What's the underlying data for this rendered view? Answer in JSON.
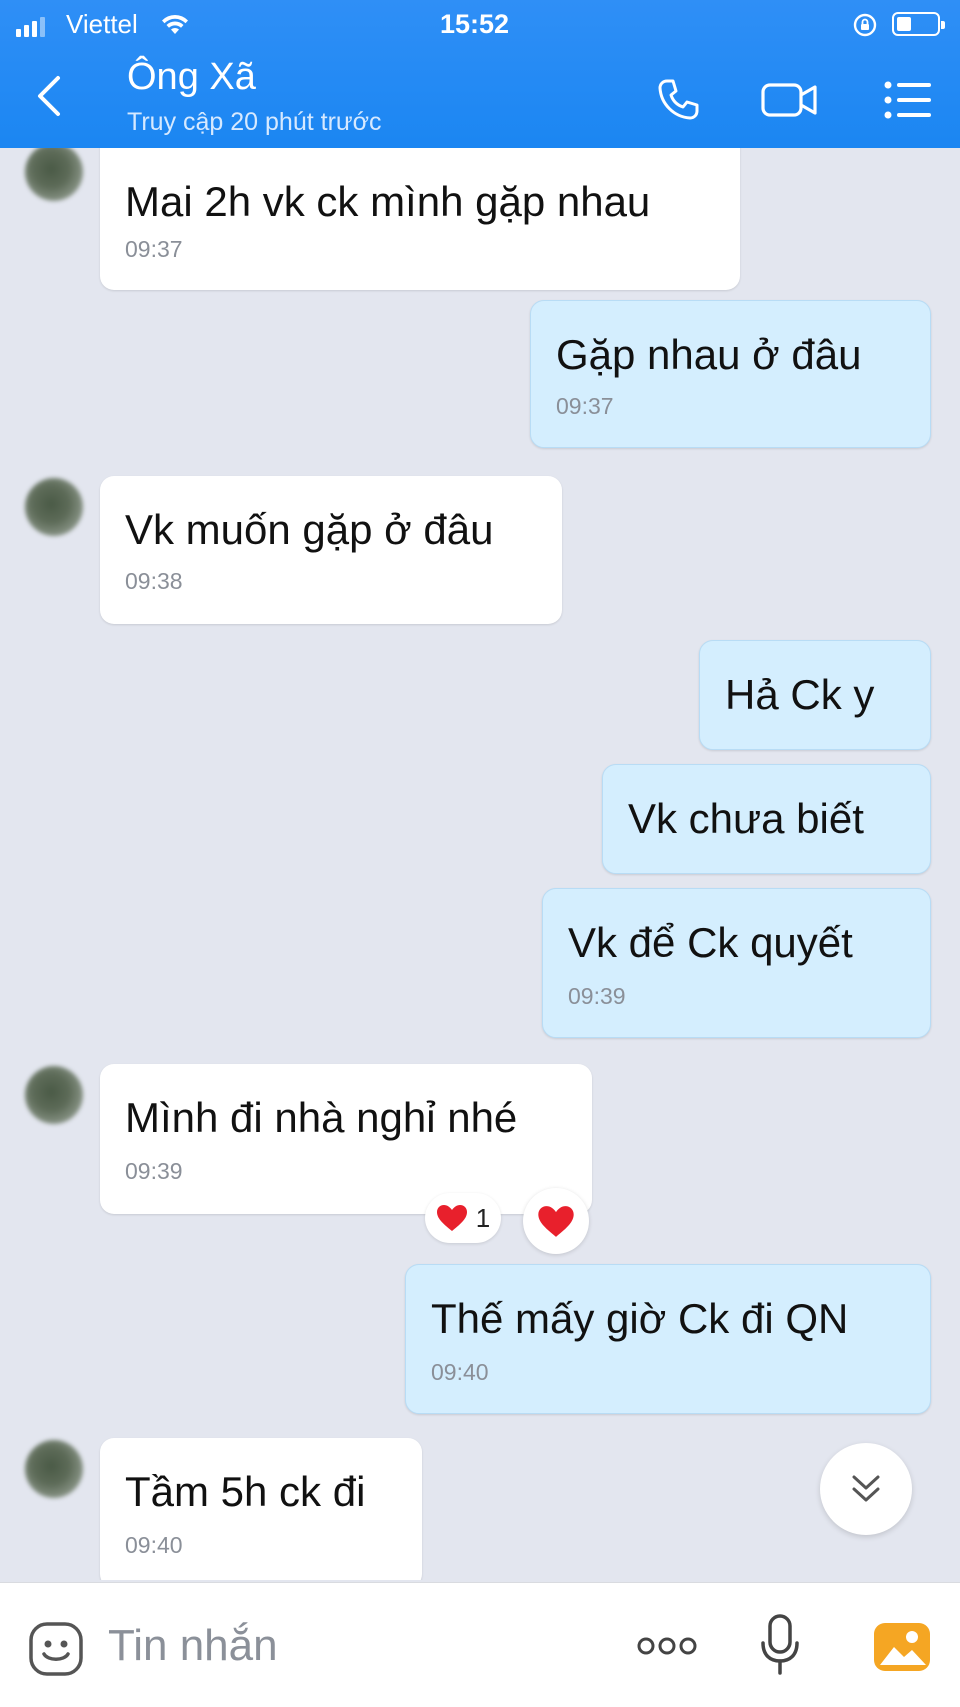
{
  "status_bar": {
    "carrier": "Viettel",
    "time": "15:52"
  },
  "header": {
    "contact_name": "Ông Xã",
    "contact_status": "Truy cập 20 phút trước",
    "icons": [
      "back-icon",
      "phone-icon",
      "video-call-icon",
      "menu-list-icon"
    ]
  },
  "messages": [
    {
      "direction": "in",
      "text": "Mai 2h vk ck mình gặp nhau",
      "time": "09:37"
    },
    {
      "direction": "out",
      "text": "Gặp nhau ở đâu",
      "time": "09:37"
    },
    {
      "direction": "in",
      "text": "Vk muốn gặp ở đâu",
      "time": "09:38"
    },
    {
      "direction": "out",
      "text": "Hả Ck y",
      "time": ""
    },
    {
      "direction": "out",
      "text": "Vk chưa biết",
      "time": ""
    },
    {
      "direction": "out",
      "text": "Vk để Ck quyết",
      "time": "09:39"
    },
    {
      "direction": "in",
      "text": "Mình đi nhà nghỉ nhé",
      "time": "09:39",
      "reaction": {
        "emoji": "heart",
        "count": "1"
      }
    },
    {
      "direction": "out",
      "text": "Thế mấy giờ Ck đi QN",
      "time": "09:40"
    },
    {
      "direction": "in",
      "text": "Tầm 5h ck đi",
      "time": "09:40"
    }
  ],
  "input": {
    "placeholder": "Tin nhắn"
  },
  "colors": {
    "header_blue": "#1b86f2",
    "incoming_bubble": "#ffffff",
    "outgoing_bubble": "#d4eefe",
    "chat_background": "#e3e6ef",
    "reaction_heart": "#e8202c",
    "image_button_orange": "#f5a623"
  }
}
